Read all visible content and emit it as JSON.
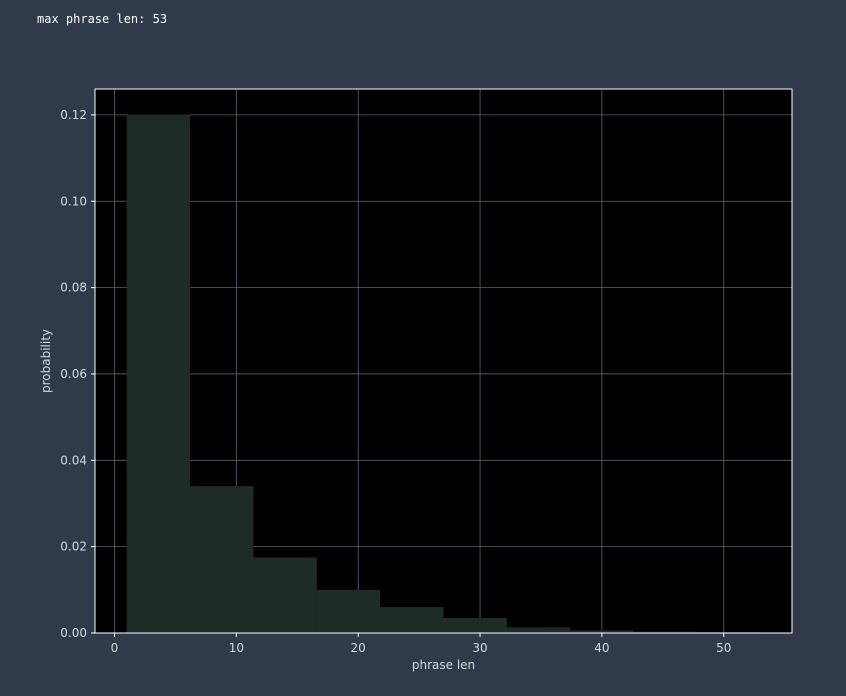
{
  "output": {
    "text": "max phrase len: 53"
  },
  "colors": {
    "page_background": "#303a4b",
    "plot_background": "#000000",
    "bar_fill": "#1f2b27",
    "grid": "#5a6170",
    "axis_frame": "#ffffff",
    "text": "#d4d8de"
  },
  "chart_data": {
    "type": "bar",
    "subtype": "histogram",
    "xlabel": "phrase len",
    "ylabel": "probability",
    "xlim": [
      -1.6,
      55.6
    ],
    "ylim": [
      0,
      0.126
    ],
    "xticks": [
      0,
      10,
      20,
      30,
      40,
      50
    ],
    "yticks": [
      0.0,
      0.02,
      0.04,
      0.06,
      0.08,
      0.1,
      0.12
    ],
    "xtick_labels": [
      "0",
      "10",
      "20",
      "30",
      "40",
      "50"
    ],
    "ytick_labels": [
      "0.00",
      "0.02",
      "0.04",
      "0.06",
      "0.08",
      "0.10",
      "0.12"
    ],
    "grid": true,
    "bins": [
      {
        "x0": 1.0,
        "x1": 6.2,
        "value": 0.1201
      },
      {
        "x0": 6.2,
        "x1": 11.4,
        "value": 0.034
      },
      {
        "x0": 11.4,
        "x1": 16.6,
        "value": 0.0175
      },
      {
        "x0": 16.6,
        "x1": 21.8,
        "value": 0.01
      },
      {
        "x0": 21.8,
        "x1": 27.0,
        "value": 0.006
      },
      {
        "x0": 27.0,
        "x1": 32.2,
        "value": 0.0035
      },
      {
        "x0": 32.2,
        "x1": 37.4,
        "value": 0.0013
      },
      {
        "x0": 37.4,
        "x1": 42.6,
        "value": 0.0006
      },
      {
        "x0": 42.6,
        "x1": 47.8,
        "value": 0.0003
      },
      {
        "x0": 47.8,
        "x1": 53.0,
        "value": 0.0002
      }
    ]
  }
}
